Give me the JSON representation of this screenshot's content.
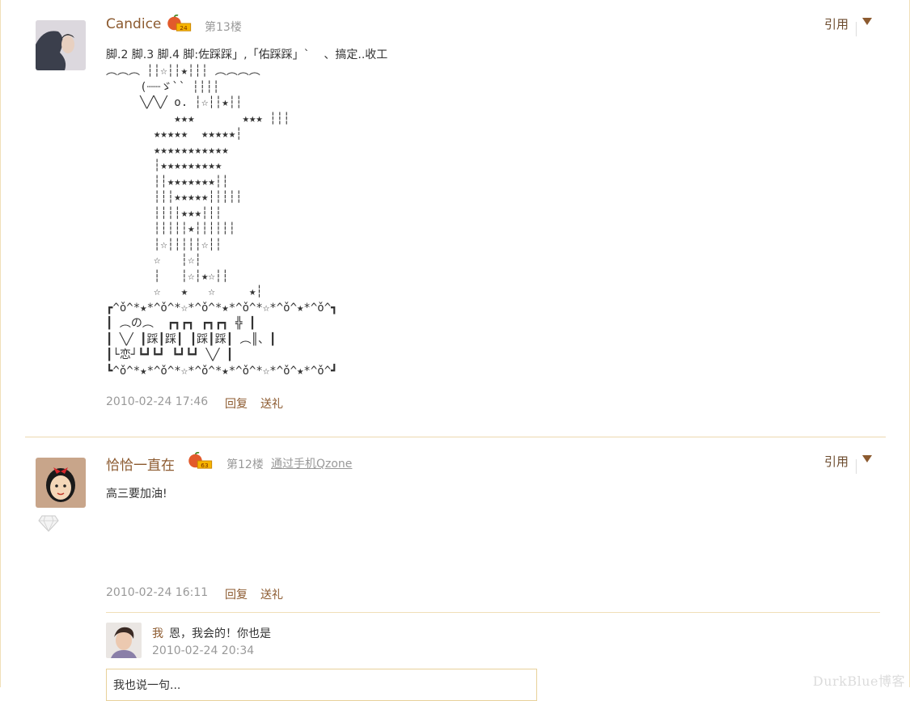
{
  "posts": [
    {
      "author": "Candice",
      "level": "24",
      "floor": "第13楼",
      "quote_label": "引用",
      "first_line": "脚.2 脚.3 脚.4 脚:佐踩踩」,「佑踩踩」`    、搞定..收工",
      "art": "︵︵︵ ┆┆☆┆┆★┆┆┆ ︵︵︵︵\n     (┈┈ゞ`` ┆┆┆┆\n     ╲╱╲╱ o. ┆☆┆┆★┆┆\n          ★★★       ★★★ ┆┆┆\n       ★★★★★  ★★★★★┆\n       ★★★★★★★★★★★\n       ┆★★★★★★★★★\n       ┆┆★★★★★★★┆┆\n       ┆┆┆★★★★★┆┆┆┆┆\n       ┆┆┆┆★★★┆┆┆\n       ┆┆┆┆┆★┆┆┆┆┆┆\n       ┆☆┆┆┆┆┆☆┆┆\n       ☆   ┆☆┆\n       ┆   ┆☆┆★☆┆┆\n       ☆   ★   ☆     ★┆\n┏^ǒ^*★*^ǒ^*☆*^ǒ^*★*^ǒ^*☆*^ǒ^★*^ǒ^┓\n┃ ︵の︵  ┏┓┏┓ ┏┓┏┓ ╬ ┃\n┃ ╲╱ ┃踩┃踩┃ ┃踩┃踩┃ ︵║、┃\n┃└恋┘┗┛┗┛ ┗┛┗┛ ╲╱ ┃\n┗^ǒ^*★*^ǒ^*☆*^ǒ^*★*^ǒ^*☆*^ǒ^★*^ǒ^┛",
      "time": "2010-02-24 17:46",
      "reply_label": "回复",
      "gift_label": "送礼"
    },
    {
      "author": "恰恰一直在",
      "level": "63",
      "floor": "第12楼",
      "via": "通过手机Qzone",
      "quote_label": "引用",
      "content": "高三要加油!",
      "time": "2010-02-24 16:11",
      "reply_label": "回复",
      "gift_label": "送礼",
      "reply": {
        "author": "我",
        "text": "恩，我会的！你也是",
        "time": "2010-02-24 20:34"
      },
      "comment_placeholder": "我也说一句..."
    }
  ],
  "watermark": "DurkBlue博客",
  "colors": {
    "author": "#8c5a2f",
    "muted": "#999999",
    "divider": "#ecd9b0",
    "accent_border": "#e8d19a"
  }
}
